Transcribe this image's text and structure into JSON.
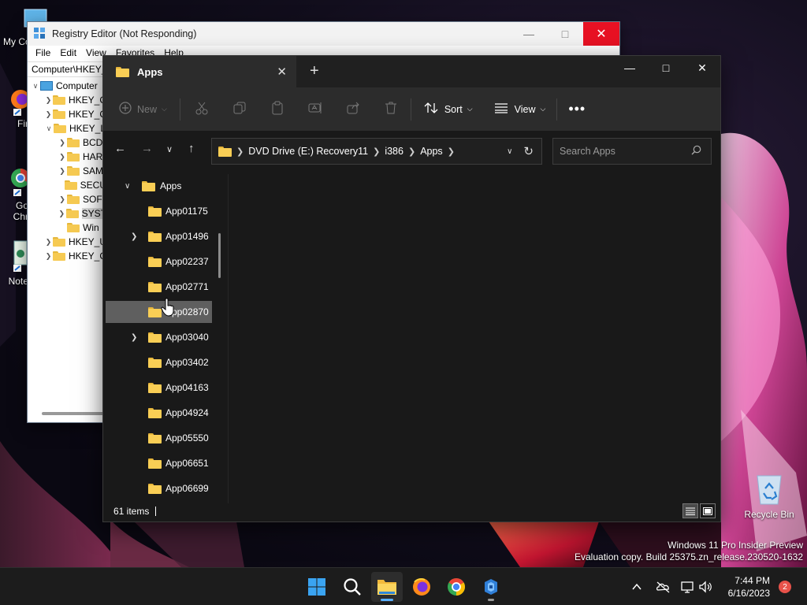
{
  "desktop": {
    "icons": [
      {
        "label": "My Co",
        "icon": "this-pc-icon"
      },
      {
        "label": "Fir",
        "icon": "firefox-icon"
      },
      {
        "label": "Go Chr",
        "icon": "chrome-icon"
      },
      {
        "label": "Note",
        "icon": "notepad-icon"
      }
    ],
    "recycle_bin": "Recycle Bin",
    "watermark": {
      "line1": "Windows 11 Pro Insider Preview",
      "line2": "Evaluation copy. Build 25375.zn_release.230520-1632"
    }
  },
  "regedit": {
    "title": "Registry Editor (Not Responding)",
    "menu": [
      "File",
      "Edit",
      "View",
      "Favorites",
      "Help"
    ],
    "address": "Computer\\HKEY_",
    "tree": [
      {
        "label": "Computer",
        "level": 0,
        "caret": "v",
        "type": "computer"
      },
      {
        "label": "HKEY_C",
        "level": 1,
        "caret": ">"
      },
      {
        "label": "HKEY_C",
        "level": 1,
        "caret": ">"
      },
      {
        "label": "HKEY_L",
        "level": 1,
        "caret": "v"
      },
      {
        "label": "BCD",
        "level": 2,
        "caret": ">"
      },
      {
        "label": "HAR",
        "level": 2,
        "caret": ">"
      },
      {
        "label": "SAM",
        "level": 2,
        "caret": ">"
      },
      {
        "label": "SECU",
        "level": 2,
        "caret": ""
      },
      {
        "label": "SOF",
        "level": 2,
        "caret": ">"
      },
      {
        "label": "SYST",
        "level": 2,
        "caret": ">",
        "selected": true
      },
      {
        "label": "Win",
        "level": 2,
        "caret": ""
      },
      {
        "label": "HKEY_U",
        "level": 1,
        "caret": ">"
      },
      {
        "label": "HKEY_C",
        "level": 1,
        "caret": ">"
      }
    ]
  },
  "explorer": {
    "tab_title": "Apps",
    "command_bar": {
      "new_label": "New",
      "sort_label": "Sort",
      "view_label": "View"
    },
    "breadcrumb": [
      "DVD Drive (E:) Recovery11",
      "i386",
      "Apps"
    ],
    "search_placeholder": "Search Apps",
    "nav_tree": {
      "root": "Apps",
      "items": [
        {
          "label": "App01175",
          "expandable": false
        },
        {
          "label": "App01496",
          "expandable": true
        },
        {
          "label": "App02237",
          "expandable": false
        },
        {
          "label": "App02771",
          "expandable": false
        },
        {
          "label": "App02870",
          "expandable": false,
          "hovered": true
        },
        {
          "label": "App03040",
          "expandable": true
        },
        {
          "label": "App03402",
          "expandable": false
        },
        {
          "label": "App04163",
          "expandable": false
        },
        {
          "label": "App04924",
          "expandable": false
        },
        {
          "label": "App05550",
          "expandable": false
        },
        {
          "label": "App06651",
          "expandable": false
        },
        {
          "label": "App06699",
          "expandable": false
        }
      ]
    },
    "status": "61 items"
  },
  "taskbar": {
    "apps": [
      "start-icon",
      "search-icon",
      "file-explorer-icon",
      "firefox-icon",
      "chrome-icon",
      "registry-editor-icon"
    ],
    "clock": {
      "time": "7:44 PM",
      "date": "6/16/2023"
    },
    "notification_count": "2"
  }
}
